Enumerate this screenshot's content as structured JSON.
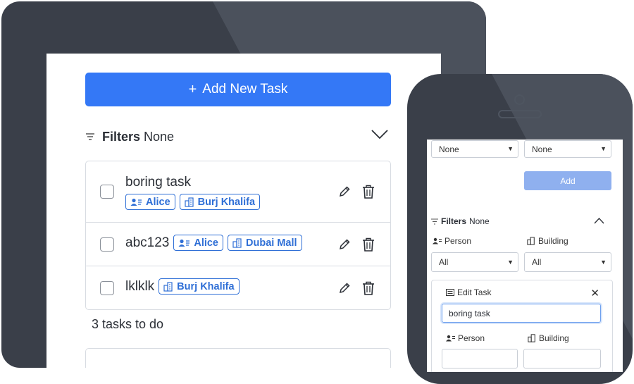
{
  "tablet": {
    "add_button_label": "Add New Task",
    "filters_title": "Filters",
    "filters_value": "None",
    "tasks": [
      {
        "title": "boring task",
        "person": "Alice",
        "building": "Burj Khalifa"
      },
      {
        "title": "abc123",
        "person": "Alice",
        "building": "Dubai Mall"
      },
      {
        "title": "lklklk",
        "person": "",
        "building": "Burj Khalifa"
      }
    ],
    "count_text": "3 tasks to do"
  },
  "phone": {
    "top_person_select": "None",
    "top_building_select": "None",
    "add_button_label": "Add",
    "filters_title": "Filters",
    "filters_value": "None",
    "person_label": "Person",
    "building_label": "Building",
    "person_filter_value": "All",
    "building_filter_value": "All",
    "edit_title": "Edit Task",
    "edit_input_value": "boring task",
    "edit_person_label": "Person",
    "edit_building_label": "Building"
  },
  "colors": {
    "accent": "#3478f6",
    "tag": "#2f6fd6",
    "device": "#3a3f49"
  },
  "icons": [
    "plus-icon",
    "filter-icon",
    "chevron-down-icon",
    "chevron-up-icon",
    "person-card-icon",
    "building-icon",
    "pencil-icon",
    "trash-icon",
    "task-card-icon",
    "close-icon"
  ]
}
